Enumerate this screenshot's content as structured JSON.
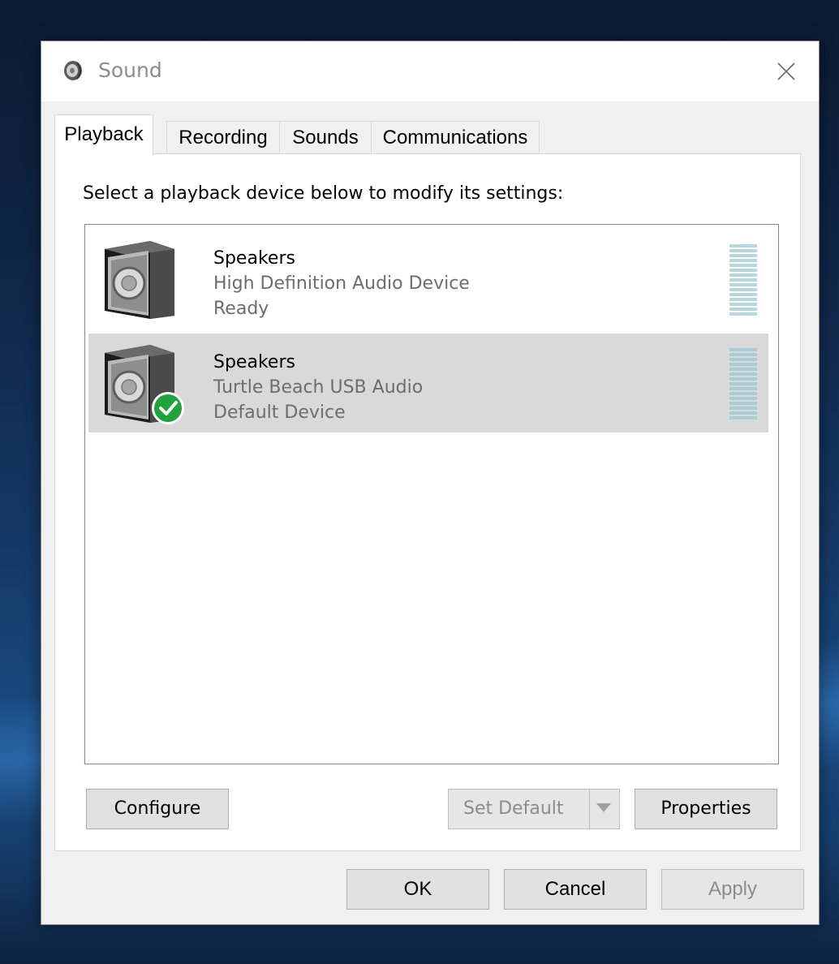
{
  "window": {
    "title": "Sound",
    "close_label": "Close"
  },
  "tabs": [
    {
      "label": "Playback",
      "active": true
    },
    {
      "label": "Recording",
      "active": false
    },
    {
      "label": "Sounds",
      "active": false
    },
    {
      "label": "Communications",
      "active": false
    }
  ],
  "playback": {
    "instruction": "Select a playback device below to modify its settings:",
    "devices": [
      {
        "name": "Speakers",
        "description": "High Definition Audio Device",
        "status": "Ready",
        "selected": false,
        "is_default": false,
        "icon": "speaker-icon"
      },
      {
        "name": "Speakers",
        "description": "Turtle Beach USB Audio",
        "status": "Default Device",
        "selected": true,
        "is_default": true,
        "icon": "speaker-icon",
        "badge_icon": "default-check-icon"
      }
    ]
  },
  "buttons": {
    "configure": "Configure",
    "set_default": "Set Default",
    "properties": "Properties",
    "ok": "OK",
    "cancel": "Cancel",
    "apply": "Apply"
  },
  "colors": {
    "selected_row": "#d9d9d9",
    "meter_bar": "#b7d7df",
    "default_badge": "#1fa33a"
  }
}
